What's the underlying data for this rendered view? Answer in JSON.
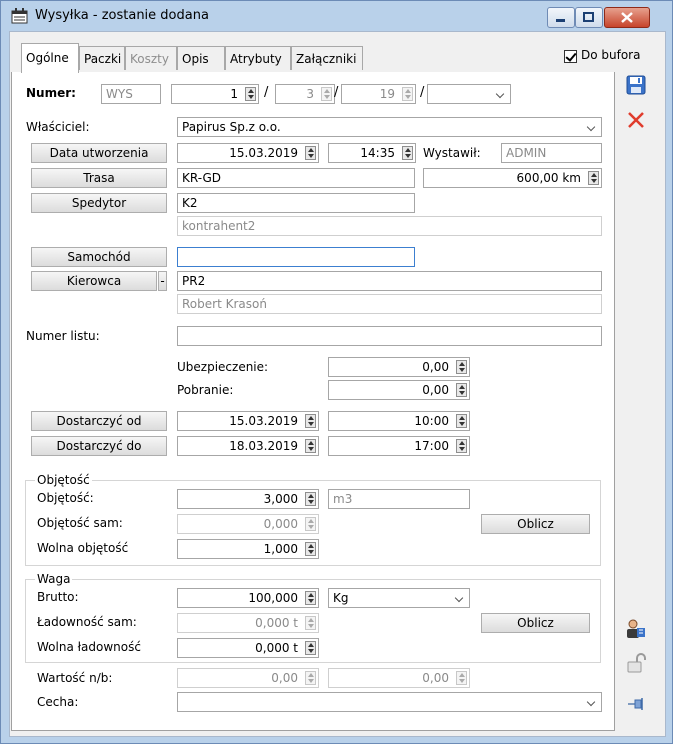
{
  "window": {
    "title": "Wysyłka - zostanie dodana"
  },
  "tabs": [
    {
      "label": "Ogólne"
    },
    {
      "label": "Paczki"
    },
    {
      "label": "Koszty"
    },
    {
      "label": "Opis"
    },
    {
      "label": "Atrybuty"
    },
    {
      "label": "Załączniki"
    }
  ],
  "do_bufora": {
    "label": "Do bufora",
    "checked": true
  },
  "numer": {
    "label": "Numer:",
    "prefix": "WYS",
    "num": "1",
    "month": "3",
    "year": "19",
    "series": ""
  },
  "wlasciciel": {
    "label": "Właściciel:",
    "value": "Papirus Sp.z o.o."
  },
  "data_utworzenia": {
    "button": "Data utworzenia",
    "date": "15.03.2019",
    "time": "14:35"
  },
  "wystawil": {
    "label": "Wystawił:",
    "value": "ADMIN"
  },
  "trasa": {
    "button": "Trasa",
    "value": "KR-GD",
    "distance": "600,00 km"
  },
  "spedytor": {
    "button": "Spedytor",
    "code": "K2",
    "name": "kontrahent2"
  },
  "samochod": {
    "button": "Samochód",
    "value": ""
  },
  "kierowca": {
    "button": "Kierowca",
    "dash": "-",
    "code": "PR2",
    "name": "Robert Krasoń"
  },
  "numer_listu": {
    "label": "Numer listu:",
    "value": ""
  },
  "ubezpieczenie": {
    "label": "Ubezpieczenie:",
    "value": "0,00"
  },
  "pobranie": {
    "label": "Pobranie:",
    "value": "0,00"
  },
  "dostarczyc_od": {
    "button": "Dostarczyć od",
    "date": "15.03.2019",
    "time": "10:00"
  },
  "dostarczyc_do": {
    "button": "Dostarczyć do",
    "date": "18.03.2019",
    "time": "17:00"
  },
  "objetosc_group": {
    "title": "Objętość",
    "objetosc_label": "Objętość:",
    "objetosc_value": "3,000",
    "unit": "m3",
    "sam_label": "Objętość sam:",
    "sam_value": "0,000",
    "wolna_label": "Wolna objętość",
    "wolna_value": "1,000",
    "oblicz": "Oblicz"
  },
  "waga_group": {
    "title": "Waga",
    "brutto_label": "Brutto:",
    "brutto_value": "100,000",
    "unit": "Kg",
    "sam_label": "Ładowność sam:",
    "sam_value": "0,000 t",
    "wolna_label": "Wolna ładowność",
    "wolna_value": "0,000 t",
    "oblicz": "Oblicz"
  },
  "wartosc": {
    "label": "Wartość n/b:",
    "value1": "0,00",
    "value2": "0,00"
  },
  "cecha": {
    "label": "Cecha:",
    "value": ""
  },
  "colors": {
    "titlebar": "#b9d1ea",
    "close": "#c7442b",
    "accent": "#3c7fd0"
  }
}
